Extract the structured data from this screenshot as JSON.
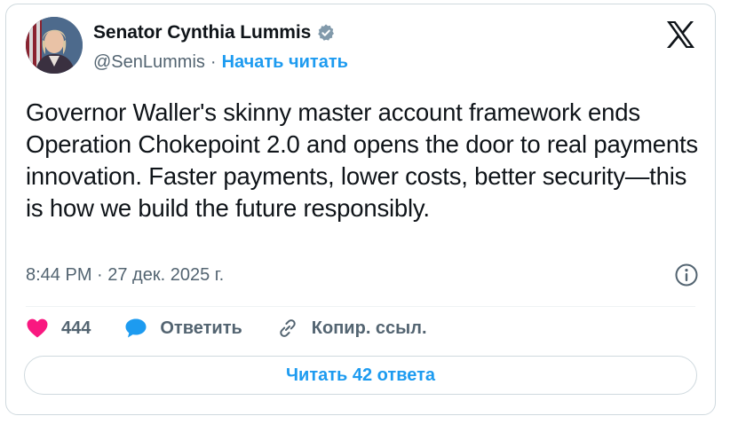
{
  "author": {
    "display_name": "Senator Cynthia Lummis",
    "handle": "@SenLummis",
    "separator": "·",
    "follow_label": "Начать читать"
  },
  "tweet": {
    "text": "Governor Waller's skinny master account framework ends Operation Chokepoint 2.0 and opens the door to real payments innovation. Faster payments, lower costs, better security—this is how we build the future responsibly.",
    "timestamp": "8:44 PM · 27 дек. 2025 г."
  },
  "actions": {
    "like_count": "444",
    "reply_label": "Ответить",
    "copy_link_label": "Копир. ссыл."
  },
  "read_replies_label": "Читать 42 ответа",
  "icons": {
    "verified": "verified-badge-icon",
    "platform": "x-logo-icon",
    "info": "info-icon",
    "like": "heart-icon",
    "reply": "speech-bubble-icon",
    "copy": "link-icon"
  },
  "colors": {
    "accent": "#1d9bf0",
    "heart": "#f91880",
    "secondary_text": "#536471",
    "primary_text": "#0f1419",
    "border": "#cfd9de"
  }
}
